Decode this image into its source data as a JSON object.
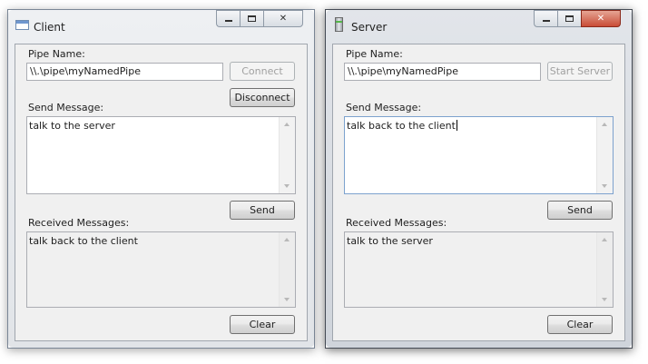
{
  "client": {
    "title": "Client",
    "pipe_label": "Pipe Name:",
    "pipe_value": "\\\\.\\pipe\\myNamedPipe",
    "connect_label": "Connect",
    "disconnect_label": "Disconnect",
    "send_label": "Send Message:",
    "send_text": "talk to the server",
    "send_button": "Send",
    "received_label": "Received Messages:",
    "received_text": "talk back to the client",
    "clear_button": "Clear"
  },
  "server": {
    "title": "Server",
    "pipe_label": "Pipe Name:",
    "pipe_value": "\\\\.\\pipe\\myNamedPipe",
    "start_label": "Start Server",
    "send_label": "Send Message:",
    "send_text": "talk back to the client",
    "send_button": "Send",
    "received_label": "Received Messages:",
    "received_text": "talk to the server",
    "clear_button": "Clear"
  },
  "icons": {
    "client_window": "window-icon",
    "server_window": "server-icon",
    "minimize": "minimize-icon",
    "maximize": "maximize-icon",
    "close": "close-icon"
  },
  "colors": {
    "close_button_active": "#c94c36",
    "focus_border": "#5a9bd5"
  }
}
